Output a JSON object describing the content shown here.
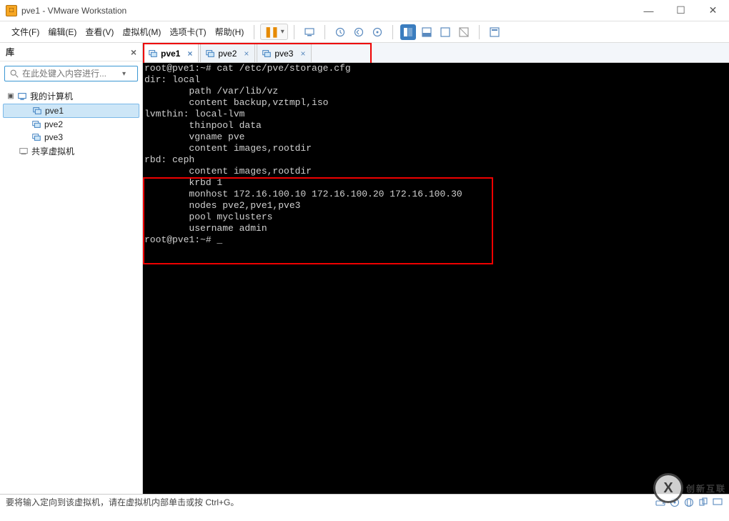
{
  "window": {
    "title": "pve1 - VMware Workstation"
  },
  "menu": {
    "file": "文件(F)",
    "edit": "编辑(E)",
    "view": "查看(V)",
    "vm": "虚拟机(M)",
    "tabs": "选项卡(T)",
    "help": "帮助(H)"
  },
  "sidebar": {
    "header": "库",
    "search_placeholder": "在此处键入内容进行...",
    "tree": {
      "root": "我的计算机",
      "items": [
        "pve1",
        "pve2",
        "pve3"
      ],
      "shared": "共享虚拟机"
    }
  },
  "tabs": [
    {
      "label": "pve1",
      "active": true
    },
    {
      "label": "pve2",
      "active": false
    },
    {
      "label": "pve3",
      "active": false
    }
  ],
  "terminal": {
    "lines": [
      "root@pve1:~# cat /etc/pve/storage.cfg",
      "dir: local",
      "        path /var/lib/vz",
      "        content backup,vztmpl,iso",
      "",
      "lvmthin: local-lvm",
      "        thinpool data",
      "        vgname pve",
      "        content images,rootdir",
      "",
      "rbd: ceph",
      "        content images,rootdir",
      "        krbd 1",
      "        monhost 172.16.100.10 172.16.100.20 172.16.100.30",
      "        nodes pve2,pve1,pve3",
      "        pool myclusters",
      "        username admin",
      "",
      "root@pve1:~# _"
    ]
  },
  "statusbar": {
    "text": "要将输入定向到该虚拟机，请在虚拟机内部单击或按 Ctrl+G。"
  },
  "watermark": {
    "logo": "X",
    "text": "创新互联"
  },
  "icons": {
    "minimize": "—",
    "maximize": "☐",
    "close": "✕",
    "pause": "❚❚",
    "dropdown": "▾",
    "tree_expand": "▣",
    "tab_close": "×",
    "sidebar_close": "×"
  }
}
